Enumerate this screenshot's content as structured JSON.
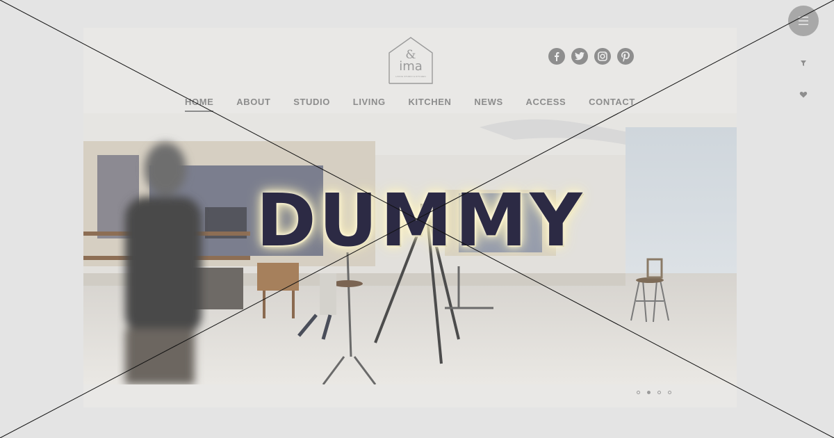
{
  "logo": {
    "amp": "&",
    "name": "ima",
    "tagline": "LIVING STUDIO & KITCHEN"
  },
  "social": [
    "facebook-icon",
    "twitter-icon",
    "instagram-icon",
    "pinterest-icon"
  ],
  "nav": {
    "items": [
      {
        "label": "HOME",
        "active": true
      },
      {
        "label": "ABOUT"
      },
      {
        "label": "STUDIO"
      },
      {
        "label": "LIVING"
      },
      {
        "label": "KITCHEN"
      },
      {
        "label": "NEWS"
      },
      {
        "label": "ACCESS"
      },
      {
        "label": "CONTACT"
      }
    ]
  },
  "hero": {
    "slide_count": 4,
    "active_slide": 2
  },
  "watermark": {
    "text": "DUMMY"
  },
  "colors": {
    "background": "#e4e4e4",
    "nav_text": "#8c8c8c",
    "icon": "#8e8e8e",
    "watermark": "#2c2a44"
  }
}
